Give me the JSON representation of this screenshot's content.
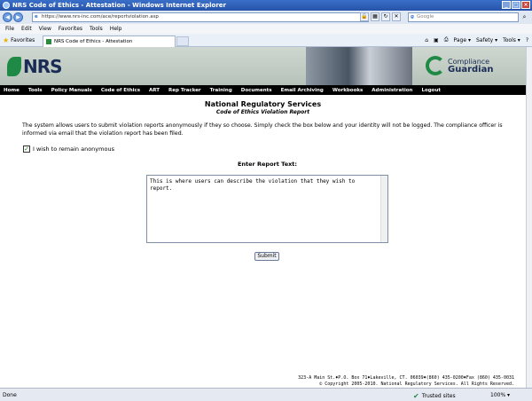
{
  "window": {
    "title": "NRS Code of Ethics - Attestation - Windows Internet Explorer"
  },
  "address": {
    "url": "https://www.nrs-inc.com/ace/reportviolation.asp",
    "search_placeholder": "Google"
  },
  "menu": [
    "File",
    "Edit",
    "View",
    "Favorites",
    "Tools",
    "Help"
  ],
  "favorites_label": "Favorites",
  "tab_title": "NRS Code of Ethics - Attestation",
  "command_bar": [
    "Page ▾",
    "Safety ▾",
    "Tools ▾",
    "?"
  ],
  "banner": {
    "logo_text": "NRS",
    "product_line1": "Compliance",
    "product_line2": "Guardian"
  },
  "nav": [
    "Home",
    "Tools",
    "Policy Manuals",
    "Code of Ethics",
    "ART",
    "Rep Tracker",
    "Training",
    "Documents",
    "Email Archiving",
    "Workbooks",
    "Administration",
    "Logout"
  ],
  "page": {
    "title": "National Regulatory Services",
    "subtitle": "Code of Ethics Violation Report",
    "intro": "The system allows users to submit violation reports anonymously if they so choose. Simply check the box below and  your identity will not be logged.  The compliance officer is informed via email that the violation report has been filed.",
    "anonymous_label": "I wish to remain anonymous",
    "anonymous_checked": true,
    "report_label": "Enter Report Text:",
    "report_text": "This is where users can describe the violation that they wish to report.",
    "submit_label": "Submit"
  },
  "footer": {
    "line1": "323-A Main St.♦P.O. Box 71♦Lakeville, CT. 06039♦(860) 435-0200♦Fax (860) 435-0031",
    "line2": "© Copyright 2005-2010. National Regulatory Services. All Rights Reserved."
  },
  "status": {
    "left": "Done",
    "zone": "Trusted sites",
    "zoom": "100% ▾"
  }
}
